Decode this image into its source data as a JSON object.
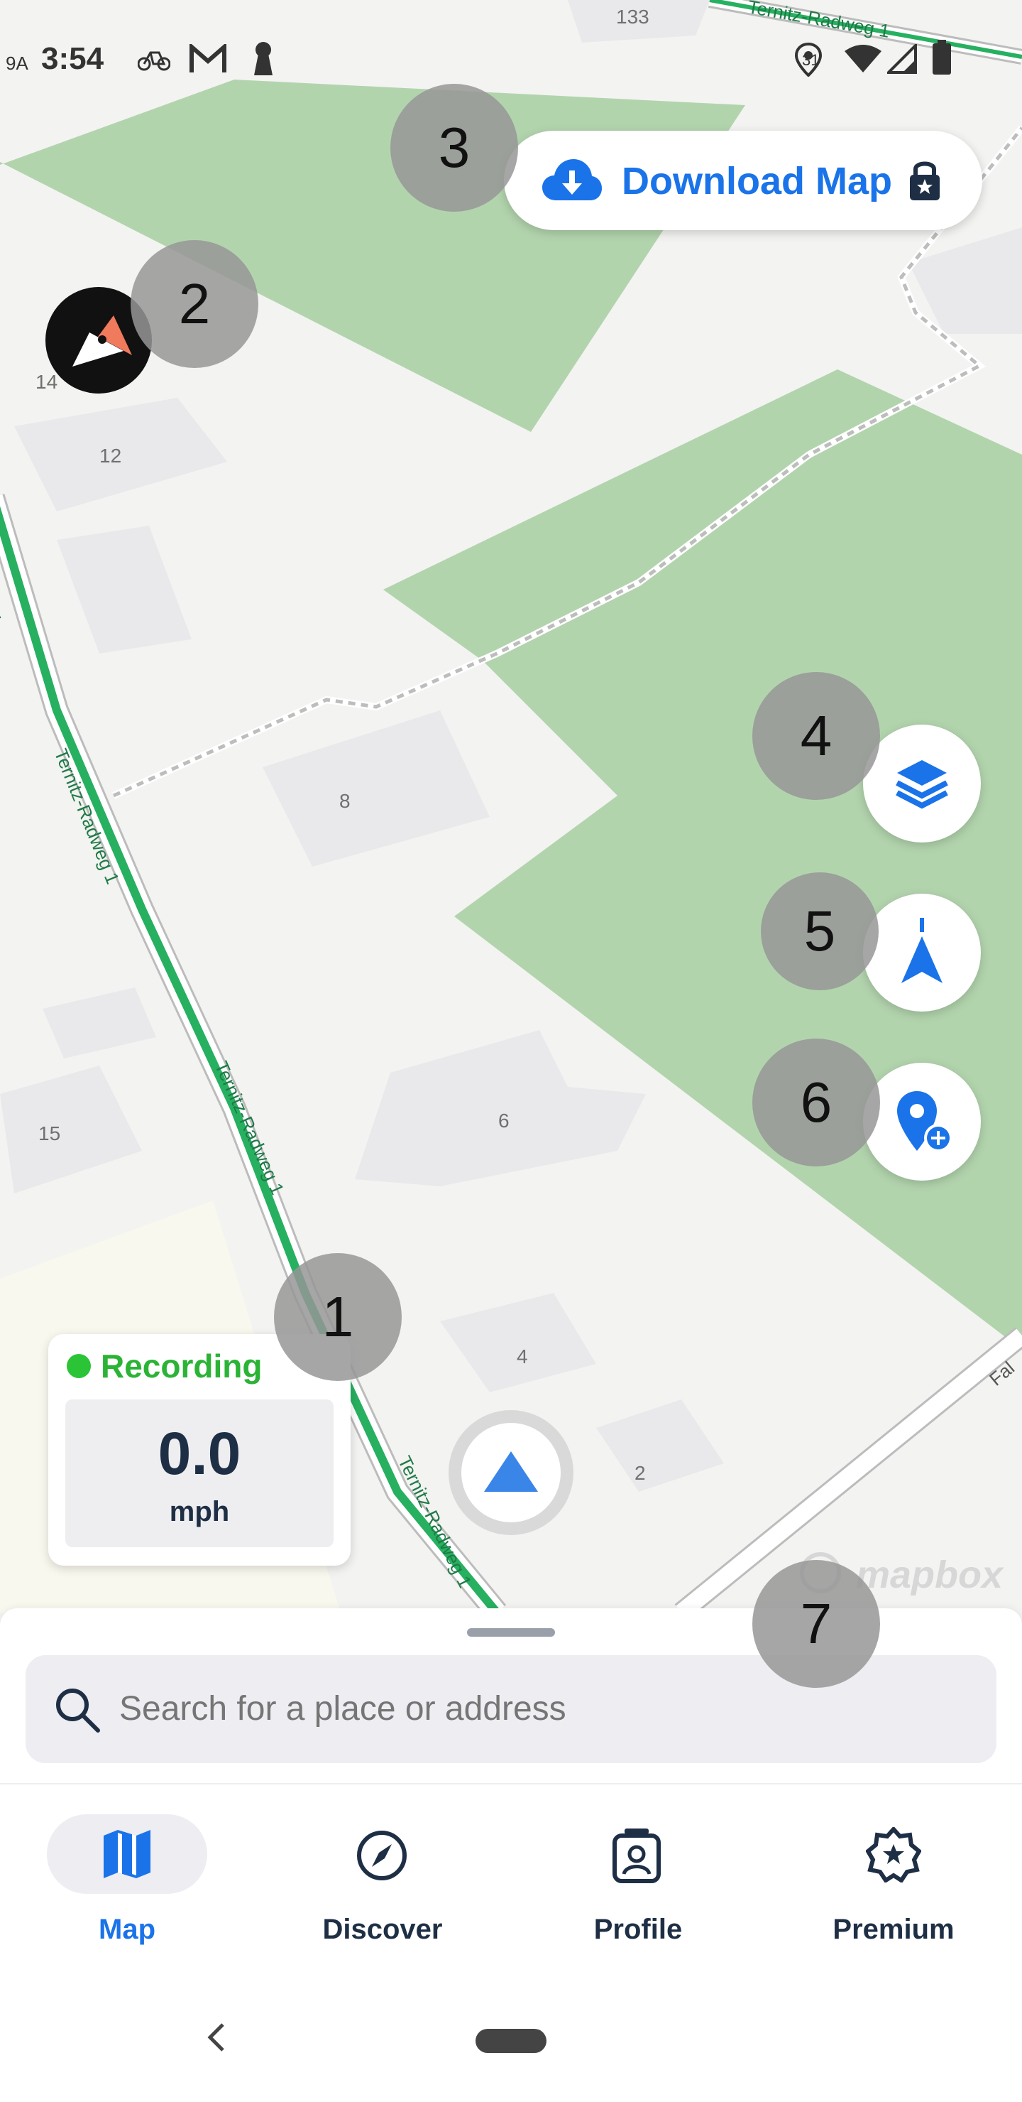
{
  "status_bar": {
    "carrier_icon": "9A",
    "time": "3:54",
    "signal_badge": "31",
    "icons": [
      "bike-icon",
      "gmail-icon",
      "keyhole-icon",
      "location-icon",
      "wifi-icon",
      "signal-icon",
      "battery-icon"
    ]
  },
  "map": {
    "house_numbers": [
      "133",
      "14",
      "12",
      "8",
      "15",
      "6",
      "4",
      "2"
    ],
    "road_name": "Ternitz-Radweg 1",
    "road_name_cut_left": "adweg1",
    "side_street": "Fal",
    "attribution": "mapbox"
  },
  "controls": {
    "download_label": "Download Map",
    "compass_label": "compass",
    "layers_label": "layers",
    "recenter_label": "recenter",
    "add_poi_label": "add place"
  },
  "markers": [
    "1",
    "2",
    "3",
    "4",
    "5",
    "6",
    "7"
  ],
  "recording": {
    "status": "Recording",
    "speed": "0.0",
    "unit": "mph"
  },
  "search": {
    "placeholder": "Search for a place or address"
  },
  "bottom_nav": {
    "items": [
      {
        "label": "Map",
        "icon": "map-icon",
        "active": true
      },
      {
        "label": "Discover",
        "icon": "compass-icon",
        "active": false
      },
      {
        "label": "Profile",
        "icon": "profile-icon",
        "active": false
      },
      {
        "label": "Premium",
        "icon": "star-badge-icon",
        "active": false
      }
    ]
  },
  "colors": {
    "accent": "#1a73e8",
    "recording": "#2bb336",
    "park": "#b2d4ad",
    "road": "#27b060"
  }
}
